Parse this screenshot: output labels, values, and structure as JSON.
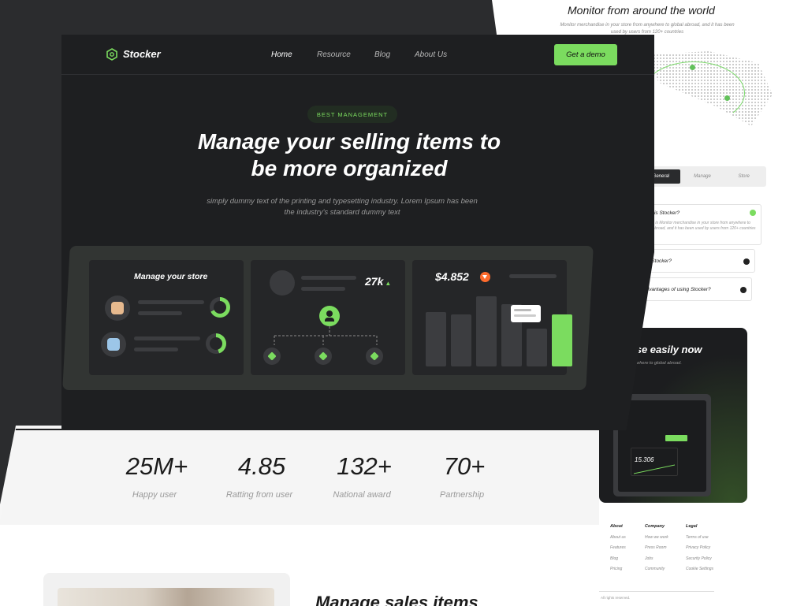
{
  "side": {
    "title": "Monitor from around the world",
    "subtitle": "Monitor merchandise in your store from anywhere to global abroad, and it has been used by users from 120+ countries",
    "tabs": [
      "General",
      "Manage",
      "Store"
    ],
    "faq": [
      {
        "q": "What is Stocker?",
        "a": "Stocker is Monitor merchandise in your store from anywhere to global abroad, and it has been used by users from 120+ countries"
      },
      {
        "q": "Why is Stocker?"
      },
      {
        "q": "What advantages of using Stocker?"
      }
    ],
    "cta_title": "andise easily now",
    "cta_sub": "from anywhere to global abroad.",
    "device_value": "15.306",
    "footer": {
      "about": {
        "h": "About",
        "items": [
          "About us",
          "Features",
          "Blog",
          "Pricing"
        ]
      },
      "company": {
        "h": "Company",
        "items": [
          "How we work",
          "Press Room",
          "Jobs",
          "Community"
        ]
      },
      "legal": {
        "h": "Legal",
        "items": [
          "Terms of use",
          "Privacy Policy",
          "Security Policy",
          "Cookie Settings"
        ]
      }
    },
    "rights": "All rights reserved."
  },
  "brand": {
    "name": "Stocker",
    "accent": "#7bdc5f"
  },
  "nav": {
    "items": [
      "Home",
      "Resource",
      "Blog",
      "About Us"
    ],
    "cta": "Get a demo"
  },
  "hero": {
    "badge": "BEST MANAGEMENT",
    "headline_1": "Manage your selling items to",
    "headline_2": "be more organized",
    "sub_1": "simply dummy text of the printing and typesetting industry. Lorem Ipsum has been",
    "sub_2": "the industry's standard dummy text"
  },
  "dashboard": {
    "card1_title": "Manage your store",
    "card2_stat": "27k",
    "card3_price": "$4.852",
    "bars": [
      0.55,
      0.52,
      0.71,
      0.63,
      0.38,
      0.52
    ]
  },
  "stats": [
    {
      "value": "25M+",
      "label": "Happy user"
    },
    {
      "value": "4.85",
      "label": "Ratting from user"
    },
    {
      "value": "132+",
      "label": "National award"
    },
    {
      "value": "70+",
      "label": "Partnership"
    }
  ],
  "lower": {
    "title": "Manage sales items"
  }
}
